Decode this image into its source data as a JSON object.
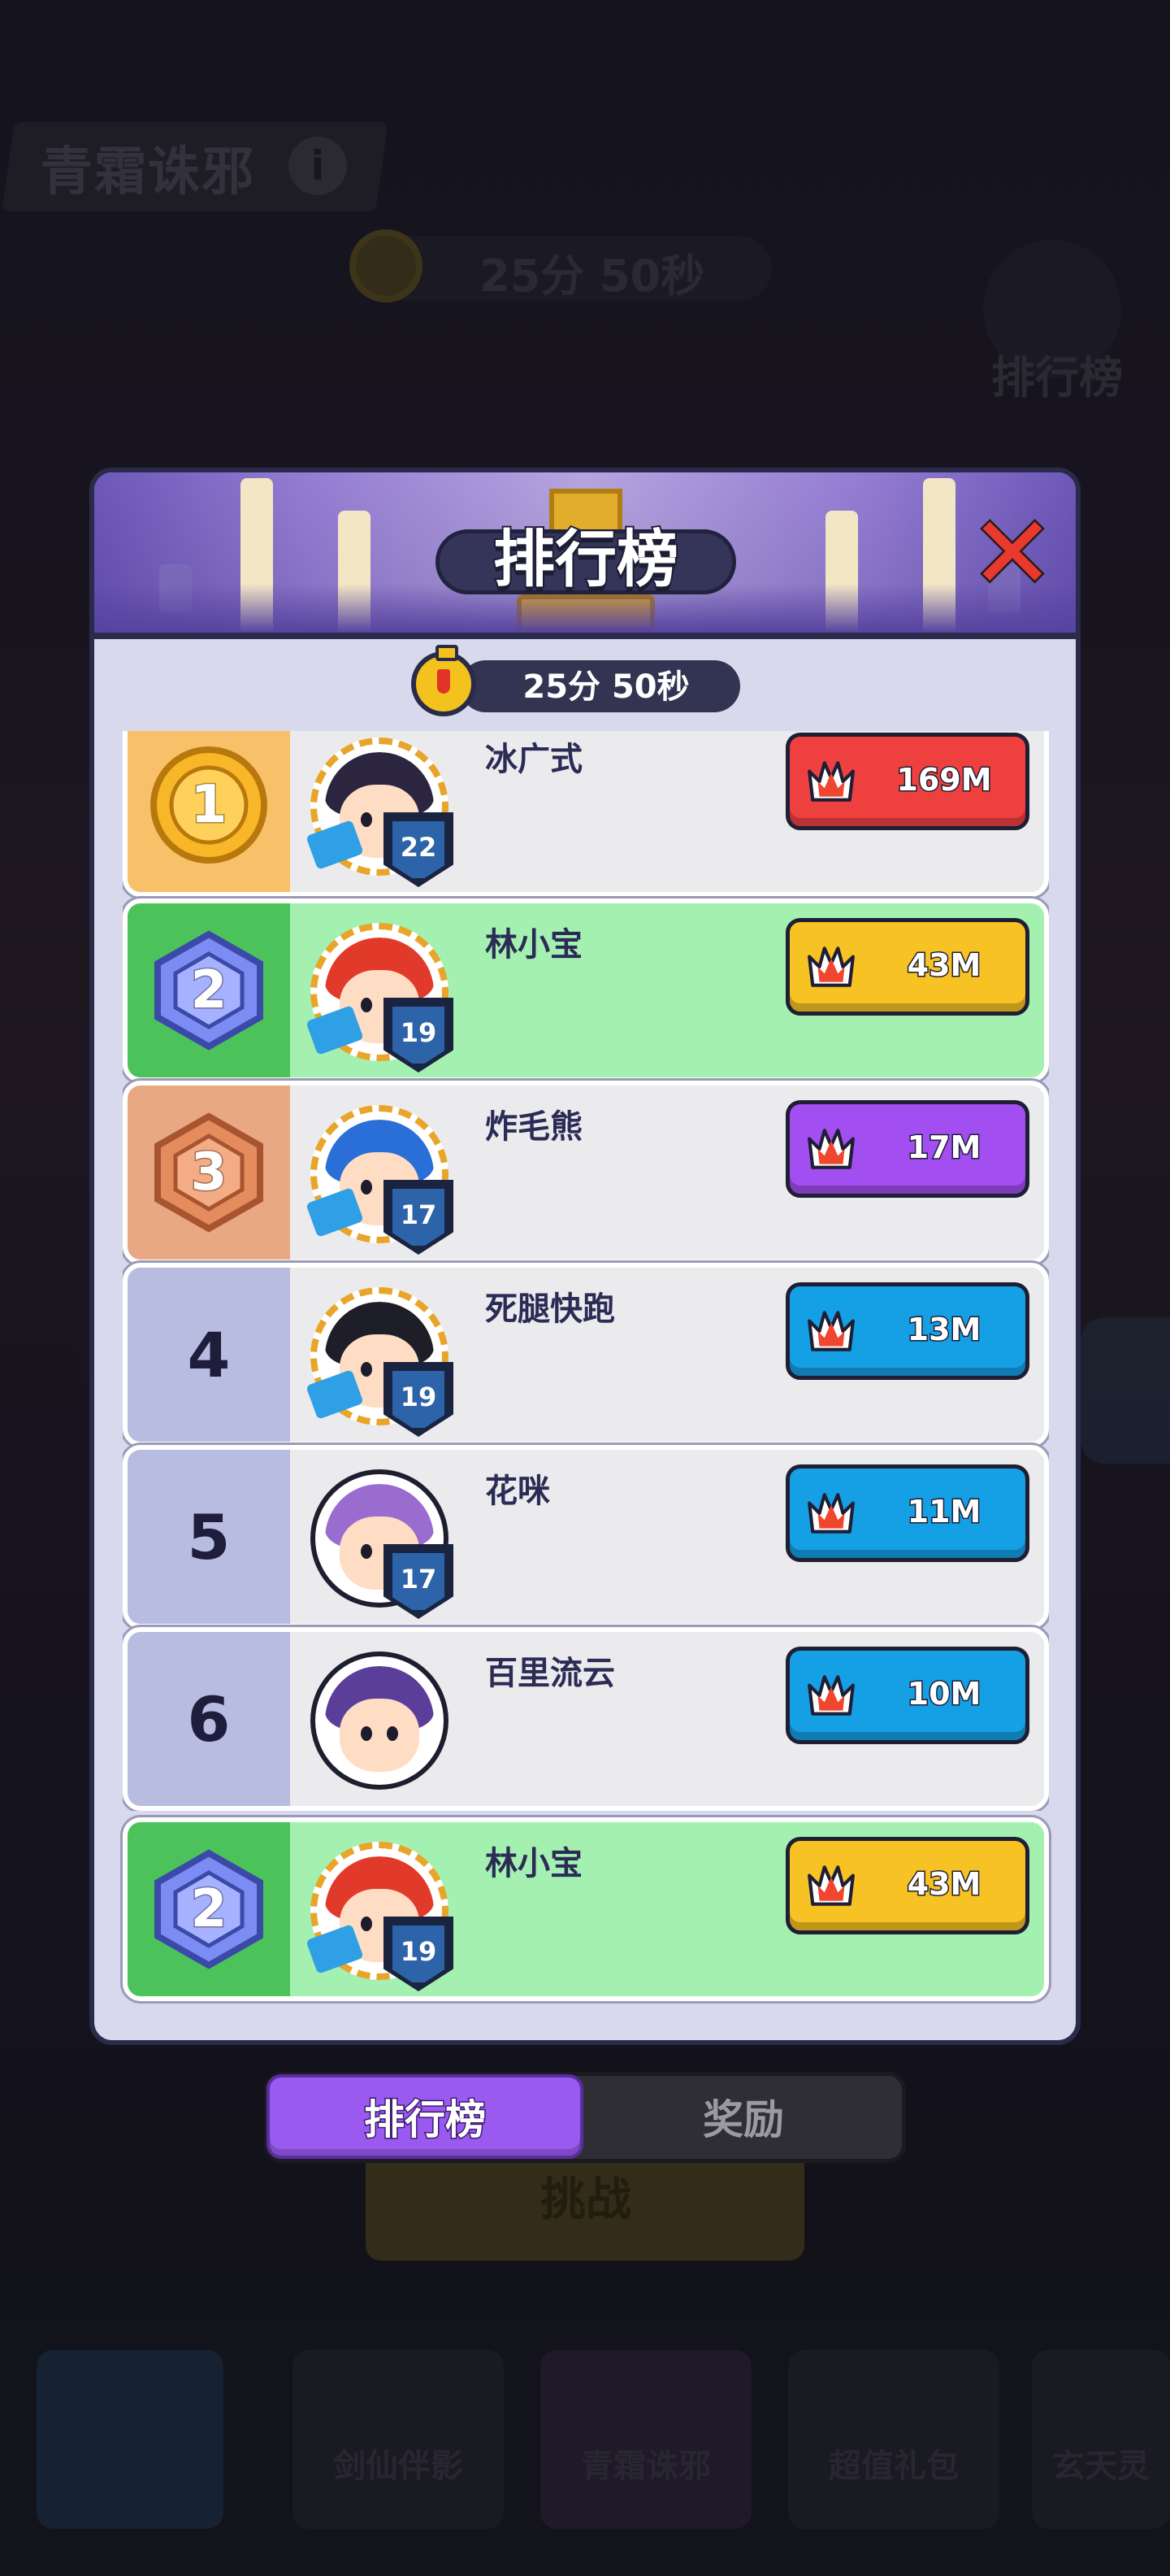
{
  "background": {
    "event_title": "青霜诛邪",
    "info_icon": "info-icon",
    "timer": "25分 50秒",
    "ranking_label": "排行榜",
    "challenge_label": "挑战",
    "nav": [
      "剑仙伴影",
      "青霜诛邪",
      "超值礼包",
      "玄天灵"
    ]
  },
  "modal": {
    "title": "排行榜",
    "close_icon": "close-icon",
    "timer": "25分 50秒",
    "timer_icon": "stopwatch-icon"
  },
  "leaderboard": [
    {
      "rank": "1",
      "name": "冰广式",
      "level": "22",
      "score": "169M",
      "color": "#ef4040",
      "rank_bg": "#f9c06a",
      "highlight": false,
      "medal": "gold"
    },
    {
      "rank": "2",
      "name": "林小宝",
      "level": "19",
      "score": "43M",
      "color": "#f7c223",
      "rank_bg": "#4cc35a",
      "highlight": true,
      "medal": "silver"
    },
    {
      "rank": "3",
      "name": "炸毛熊",
      "level": "17",
      "score": "17M",
      "color": "#a24ef0",
      "rank_bg": "#e8a884",
      "highlight": false,
      "medal": "bronze"
    },
    {
      "rank": "4",
      "name": "死腿快跑",
      "level": "19",
      "score": "13M",
      "color": "#159fe4",
      "rank_bg": "#b7bce0",
      "highlight": false,
      "medal": ""
    },
    {
      "rank": "5",
      "name": "花咪",
      "level": "17",
      "score": "11M",
      "color": "#159fe4",
      "rank_bg": "#b7bce0",
      "highlight": false,
      "medal": ""
    },
    {
      "rank": "6",
      "name": "百里流云",
      "level": "",
      "score": "10M",
      "color": "#159fe4",
      "rank_bg": "#b7bce0",
      "highlight": false,
      "medal": ""
    }
  ],
  "my_entry": {
    "rank": "2",
    "name": "林小宝",
    "level": "19",
    "score": "43M",
    "color": "#f7c223"
  },
  "tabs": [
    {
      "label": "排行榜",
      "active": true
    },
    {
      "label": "奖励",
      "active": false
    }
  ],
  "score_icon": "flame-icon"
}
